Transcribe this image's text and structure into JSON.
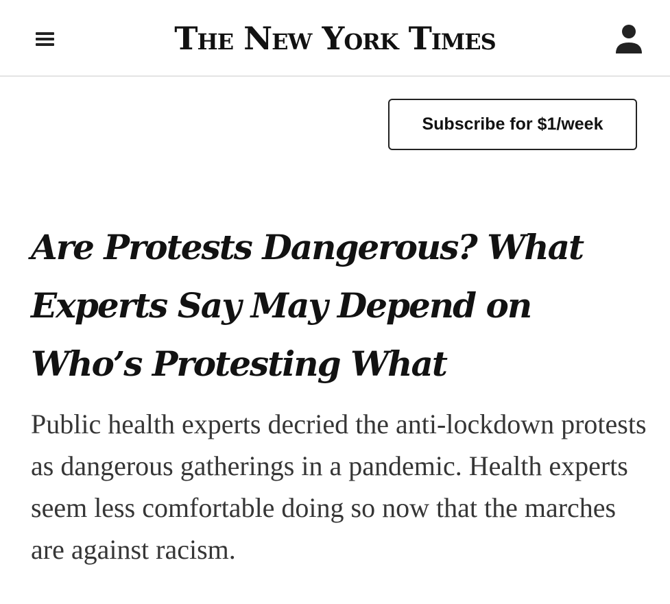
{
  "header": {
    "menu_icon": "hamburger-menu-icon",
    "masthead": "The New York Times",
    "account_icon": "user-account-icon"
  },
  "subscribe": {
    "label": "Subscribe for $1/week"
  },
  "article": {
    "headline": "Are Protests Dangerous? What Experts Say May Depend on Who’s Protesting What",
    "summary": "Public health experts decried the anti-lockdown protests as dangerous gatherings in a pandemic. Health experts seem less comfortable doing so now that the marches are against racism."
  }
}
